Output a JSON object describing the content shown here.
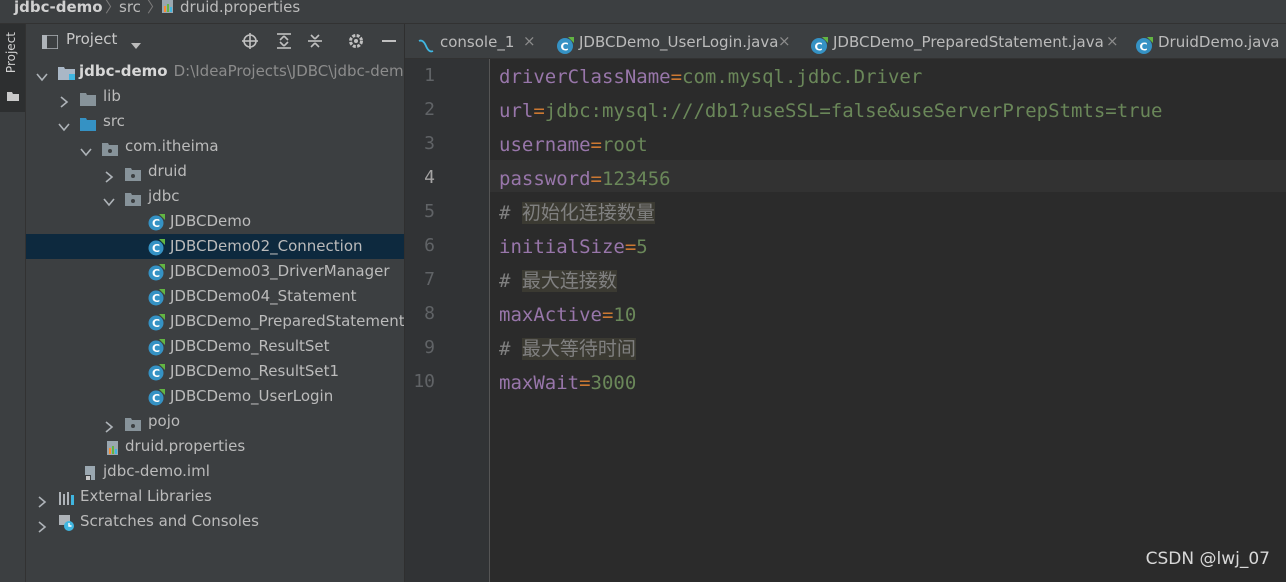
{
  "breadcrumb": {
    "project": "jdbc-demo",
    "folder": "src",
    "file": "druid.properties"
  },
  "sidebar_tab": {
    "label": "Project"
  },
  "panel": {
    "title": "Project",
    "tree": [
      {
        "label": "jdbc-demo",
        "path": "D:\\IdeaProjects\\JDBC\\jdbc-demo",
        "icon": "module-icon",
        "state": "expanded"
      },
      {
        "label": "lib",
        "icon": "folder-icon",
        "state": "collapsed"
      },
      {
        "label": "src",
        "icon": "source-folder-icon",
        "state": "expanded"
      },
      {
        "label": "com.itheima",
        "icon": "package-icon",
        "state": "expanded"
      },
      {
        "label": "druid",
        "icon": "package-icon",
        "state": "collapsed"
      },
      {
        "label": "jdbc",
        "icon": "package-icon",
        "state": "expanded"
      },
      {
        "label": "JDBCDemo",
        "icon": "java-class-icon"
      },
      {
        "label": "JDBCDemo02_Connection",
        "icon": "java-class-icon",
        "selected": true
      },
      {
        "label": "JDBCDemo03_DriverManager",
        "icon": "java-class-icon"
      },
      {
        "label": "JDBCDemo04_Statement",
        "icon": "java-class-icon"
      },
      {
        "label": "JDBCDemo_PreparedStatement",
        "icon": "java-class-icon"
      },
      {
        "label": "JDBCDemo_ResultSet",
        "icon": "java-class-icon"
      },
      {
        "label": "JDBCDemo_ResultSet1",
        "icon": "java-class-icon"
      },
      {
        "label": "JDBCDemo_UserLogin",
        "icon": "java-class-icon"
      },
      {
        "label": "pojo",
        "icon": "package-icon",
        "state": "collapsed"
      },
      {
        "label": "druid.properties",
        "icon": "properties-file-icon"
      },
      {
        "label": "jdbc-demo.iml",
        "icon": "iml-file-icon"
      },
      {
        "label": "External Libraries",
        "icon": "libraries-icon",
        "state": "collapsed"
      },
      {
        "label": "Scratches and Consoles",
        "icon": "scratches-icon",
        "state": "collapsed"
      }
    ]
  },
  "tabs": [
    {
      "label": "console_1",
      "icon": "console-icon"
    },
    {
      "label": "JDBCDemo_UserLogin.java",
      "icon": "java-class-icon"
    },
    {
      "label": "JDBCDemo_PreparedStatement.java",
      "icon": "java-class-icon"
    },
    {
      "label": "DruidDemo.java",
      "icon": "java-class-icon"
    }
  ],
  "tab_close_glyph": "×",
  "editor": {
    "current_line": 4,
    "lines": [
      {
        "n": "1",
        "key": "driverClassName",
        "eq": "=",
        "value": "com.mysql.jdbc.Driver"
      },
      {
        "n": "2",
        "key": "url",
        "eq": "=",
        "value": "jdbc:mysql:///db1?useSSL=false&useServerPrepStmts=true"
      },
      {
        "n": "3",
        "key": "username",
        "eq": "=",
        "value": "root"
      },
      {
        "n": "4",
        "key": "password",
        "eq": "=",
        "value": "123456"
      },
      {
        "n": "5",
        "hash": "#",
        "comment": "初始化连接数量"
      },
      {
        "n": "6",
        "key": "initialSize",
        "eq": "=",
        "value": "5"
      },
      {
        "n": "7",
        "hash": "#",
        "comment": "最大连接数"
      },
      {
        "n": "8",
        "key": "maxActive",
        "eq": "=",
        "value": "10"
      },
      {
        "n": "9",
        "hash": "#",
        "comment": "最大等待时间"
      },
      {
        "n": "10",
        "key": "maxWait",
        "eq": "=",
        "value": "3000"
      }
    ]
  },
  "watermark": "CSDN @lwj_07",
  "colors": {
    "background": "#2b2b2b",
    "panel": "#3c3f41",
    "selection": "#0d293e",
    "value": "#6a8759",
    "key": "#cc7832",
    "comment_highlight": "#3b3a32"
  }
}
